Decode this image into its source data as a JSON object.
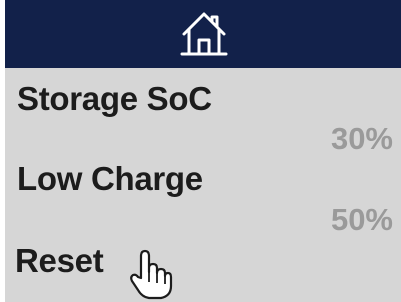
{
  "header": {
    "home_icon": "home-icon"
  },
  "rows": [
    {
      "label": "Storage SoC",
      "value": "30%"
    },
    {
      "label": "Low Charge",
      "value": "50%"
    },
    {
      "label": "Reset"
    }
  ],
  "colors": {
    "header_bg": "#12214a",
    "panel_bg": "#d6d6d6",
    "label": "#1c1c1c",
    "value": "#9a9a9a"
  },
  "cursor_icon": "hand-pointer-icon"
}
